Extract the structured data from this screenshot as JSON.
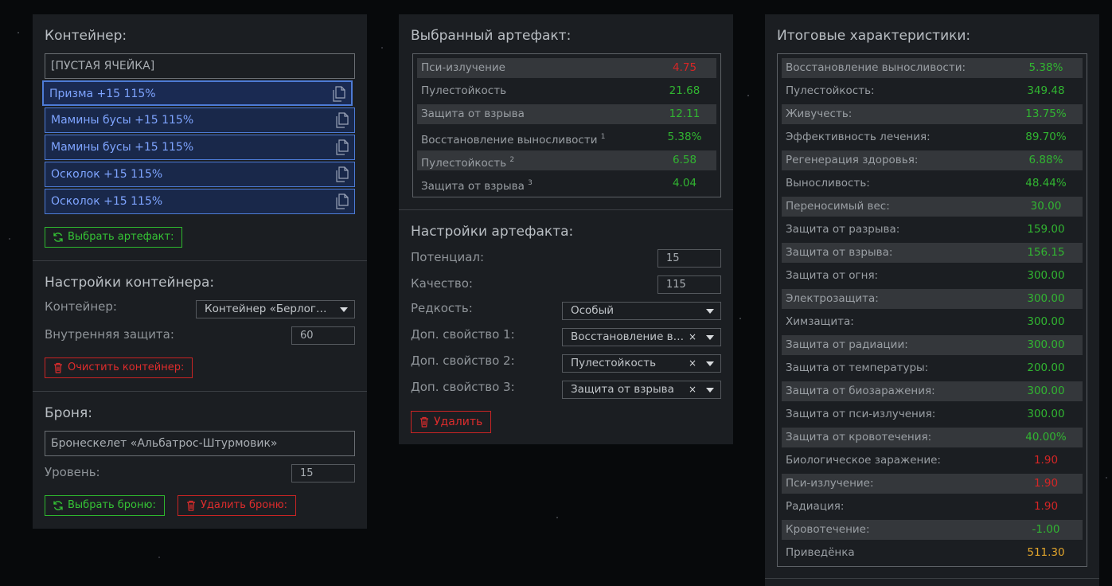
{
  "container_panel": {
    "title": "Контейнер:",
    "empty_slot": "[ПУСТАЯ ЯЧЕЙКА]",
    "slots": [
      "Призма +15 115%",
      "Мамины бусы +15 115%",
      "Мамины бусы +15 115%",
      "Осколок +15 115%",
      "Осколок +15 115%"
    ],
    "choose_artifact_button": "Выбрать артефакт:",
    "settings_title": "Настройки контейнера:",
    "container_label": "Контейнер:",
    "container_value": "Контейнер «Берлога…",
    "inner_protection_label": "Внутренняя защита:",
    "inner_protection_value": "60",
    "clear_container_button": "Очистить контейнер:",
    "armor_title": "Броня:",
    "armor_value": "Бронескелет «Альбатрос-Штурмовик»",
    "level_label": "Уровень:",
    "level_value": "15",
    "choose_armor_button": "Выбрать броню:",
    "delete_armor_button": "Удалить броню:"
  },
  "artifact_panel": {
    "title": "Выбранный артефакт:",
    "stats": [
      {
        "name": "Пси-излучение",
        "sup": "",
        "value": "4.75",
        "color": "red"
      },
      {
        "name": "Пулестойкость",
        "sup": "",
        "value": "21.68",
        "color": "green"
      },
      {
        "name": "Защита от взрыва",
        "sup": "",
        "value": "12.11",
        "color": "green"
      },
      {
        "name": "Восстановление выносливости",
        "sup": "1",
        "value": "5.38%",
        "color": "green"
      },
      {
        "name": "Пулестойкость",
        "sup": "2",
        "value": "6.58",
        "color": "green"
      },
      {
        "name": "Защита от взрыва",
        "sup": "3",
        "value": "4.04",
        "color": "green"
      }
    ],
    "settings_title": "Настройки артефакта:",
    "potential_label": "Потенциал:",
    "potential_value": "15",
    "quality_label": "Качество:",
    "quality_value": "115",
    "rarity_label": "Редкость:",
    "rarity_value": "Особый",
    "extra1_label": "Доп. свойство 1:",
    "extra1_value": "Восстановление в…",
    "extra2_label": "Доп. свойство 2:",
    "extra2_value": "Пулестойкость",
    "extra3_label": "Доп. свойство 3:",
    "extra3_value": "Защита от взрыва",
    "clear_symbol": "×",
    "delete_button": "Удалить"
  },
  "totals_panel": {
    "title": "Итоговые характеристики:",
    "stats": [
      {
        "name": "Восстановление выносливости:",
        "value": "5.38%",
        "color": "green"
      },
      {
        "name": "Пулестойкость:",
        "value": "349.48",
        "color": "green"
      },
      {
        "name": "Живучесть:",
        "value": "13.75%",
        "color": "green"
      },
      {
        "name": "Эффективность лечения:",
        "value": "89.70%",
        "color": "green"
      },
      {
        "name": "Регенерация здоровья:",
        "value": "6.88%",
        "color": "green"
      },
      {
        "name": "Выносливость:",
        "value": "48.44%",
        "color": "green"
      },
      {
        "name": "Переносимый вес:",
        "value": "30.00",
        "color": "green"
      },
      {
        "name": "Защита от разрыва:",
        "value": "159.00",
        "color": "green"
      },
      {
        "name": "Защита от взрыва:",
        "value": "156.15",
        "color": "green"
      },
      {
        "name": "Защита от огня:",
        "value": "300.00",
        "color": "green"
      },
      {
        "name": "Электрозащита:",
        "value": "300.00",
        "color": "green"
      },
      {
        "name": "Химзащита:",
        "value": "300.00",
        "color": "green"
      },
      {
        "name": "Защита от радиации:",
        "value": "300.00",
        "color": "green"
      },
      {
        "name": "Защита от температуры:",
        "value": "200.00",
        "color": "green"
      },
      {
        "name": "Защита от биозаражения:",
        "value": "300.00",
        "color": "green"
      },
      {
        "name": "Защита от пси-излучения:",
        "value": "300.00",
        "color": "green"
      },
      {
        "name": "Защита от кровотечения:",
        "value": "40.00%",
        "color": "green"
      },
      {
        "name": "Биологическое заражение:",
        "value": "1.90",
        "color": "red"
      },
      {
        "name": "Пси-излучение:",
        "value": "1.90",
        "color": "red"
      },
      {
        "name": "Радиация:",
        "value": "1.90",
        "color": "red"
      },
      {
        "name": "Кровотечение:",
        "value": "-1.00",
        "color": "green"
      },
      {
        "name": "Приведёнка",
        "value": "511.30",
        "color": "orange"
      }
    ]
  }
}
